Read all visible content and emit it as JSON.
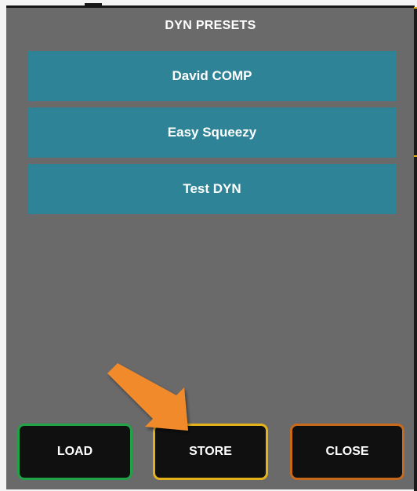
{
  "title": "DYN PRESETS",
  "presets": [
    {
      "label": "David COMP"
    },
    {
      "label": "Easy Squeezy"
    },
    {
      "label": "Test DYN"
    }
  ],
  "buttons": {
    "load": "LOAD",
    "store": "STORE",
    "close": "CLOSE"
  },
  "colors": {
    "panel": "#6a6a6a",
    "preset": "#2e8397",
    "load_border": "#1fa346",
    "store_border": "#e3b21a",
    "close_border": "#c8691a",
    "annotation_arrow": "#f08a2a"
  },
  "annotation": {
    "icon": "arrow-pointing-to-store-button"
  }
}
